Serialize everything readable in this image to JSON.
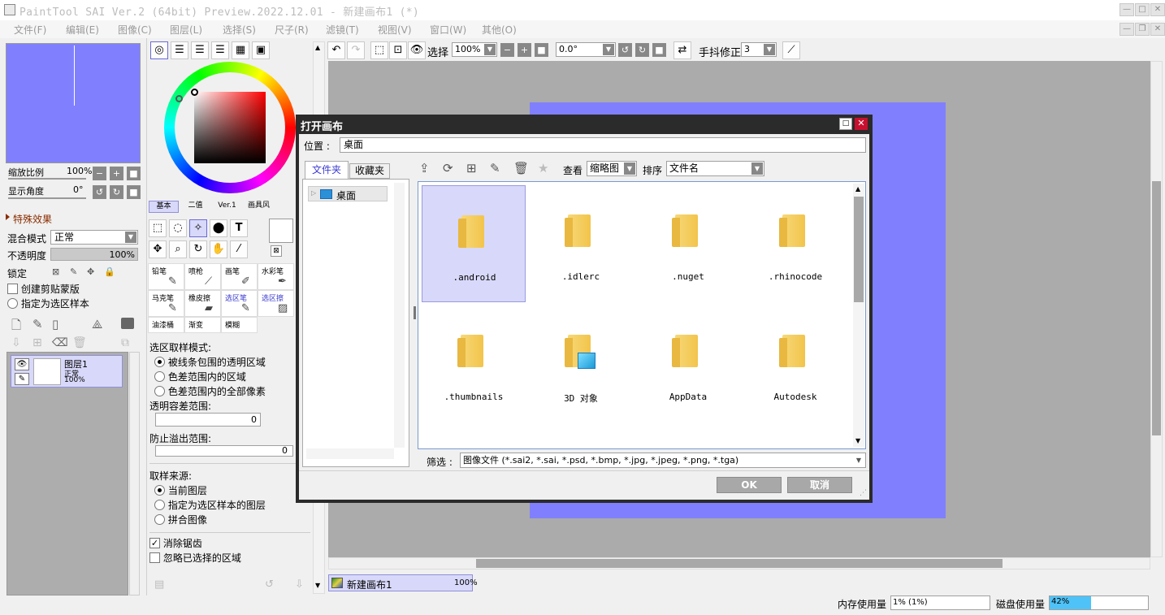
{
  "window": {
    "title": "PaintTool SAI Ver.2 (64bit) Preview.2022.12.01 - 新建画布1 (*)"
  },
  "menu": [
    "文件(F)",
    "编辑(E)",
    "图像(C)",
    "图层(L)",
    "选择(S)",
    "尺子(R)",
    "滤镜(T)",
    "视图(V)",
    "窗口(W)",
    "其他(O)"
  ],
  "navigator": {
    "zoom_label": "缩放比例",
    "zoom_value": "100%",
    "angle_label": "显示角度",
    "angle_value": "0°"
  },
  "layer_panel": {
    "effects_label": "特殊效果",
    "blend_label": "混合模式",
    "blend_value": "正常",
    "opacity_label": "不透明度",
    "opacity_value": "100%",
    "lock_label": "锁定",
    "clip_label": "创建剪贴蒙版",
    "select_src_label": "指定为选区样本",
    "layer": {
      "name": "图层1",
      "mode": "正常",
      "opacity": "100%"
    }
  },
  "color_tabs": [
    "基本",
    "二值",
    "Ver.1",
    "画具风"
  ],
  "brushes": [
    {
      "label": "铅笔"
    },
    {
      "label": "喷枪"
    },
    {
      "label": "画笔"
    },
    {
      "label": "水彩笔"
    },
    {
      "label": "马克笔"
    },
    {
      "label": "橡皮擦"
    },
    {
      "label": "选区笔"
    },
    {
      "label": "选区擦"
    },
    {
      "label": "油漆桶"
    },
    {
      "label": "渐变"
    },
    {
      "label": "模糊"
    }
  ],
  "tool_options": {
    "mode_label": "选区取样模式:",
    "modes": [
      "被线条包围的透明区域",
      "色差范围内的区域",
      "色差范围内的全部像素"
    ],
    "tolerance_label": "透明容差范围:",
    "tolerance_value": "0",
    "overflow_label": "防止溢出范围:",
    "overflow_value": "0",
    "source_label": "取样来源:",
    "sources": [
      "当前图层",
      "指定为选区样本的图层",
      "拼合图像"
    ],
    "antialias_label": "消除锯齿",
    "ignore_label": "忽略已选择的区域"
  },
  "canvas_toolbar": {
    "select_label": "选择",
    "zoom": "100%",
    "angle": "0.0°",
    "stabilizer_label": "手抖修正",
    "stabilizer_value": "3"
  },
  "document_tab": {
    "name": "新建画布1",
    "zoom": "100%"
  },
  "status": {
    "memory_label": "内存使用量",
    "memory_value": "1% (1%)",
    "disk_label": "磁盘使用量",
    "disk_value": "42%",
    "disk_fraction": 0.42
  },
  "dialog": {
    "title": "打开画布",
    "location_label": "位置 :",
    "location_value": "桌面",
    "tab_folders": "文件夹",
    "tab_favorites": "收藏夹",
    "tree_item": "桌面",
    "view_label": "查看",
    "view_value": "缩略图",
    "sort_label": "排序",
    "sort_value": "文件名",
    "files": [
      ".android",
      ".idlerc",
      ".nuget",
      ".rhinocode",
      ".thumbnails",
      "3D 对象",
      "AppData",
      "Autodesk"
    ],
    "filter_label": "筛选 :",
    "filter_value": "图像文件 (*.sai2, *.sai, *.psd, *.bmp, *.jpg, *.jpeg, *.png, *.tga)",
    "ok_label": "OK",
    "cancel_label": "取消"
  },
  "colors": {
    "canvas": "#8080ff",
    "selected_file": "#d8d8fa",
    "dialog_frame": "#2b2b2b",
    "close_button": "#c8102e",
    "disk_bar": "#4fc3f7"
  }
}
